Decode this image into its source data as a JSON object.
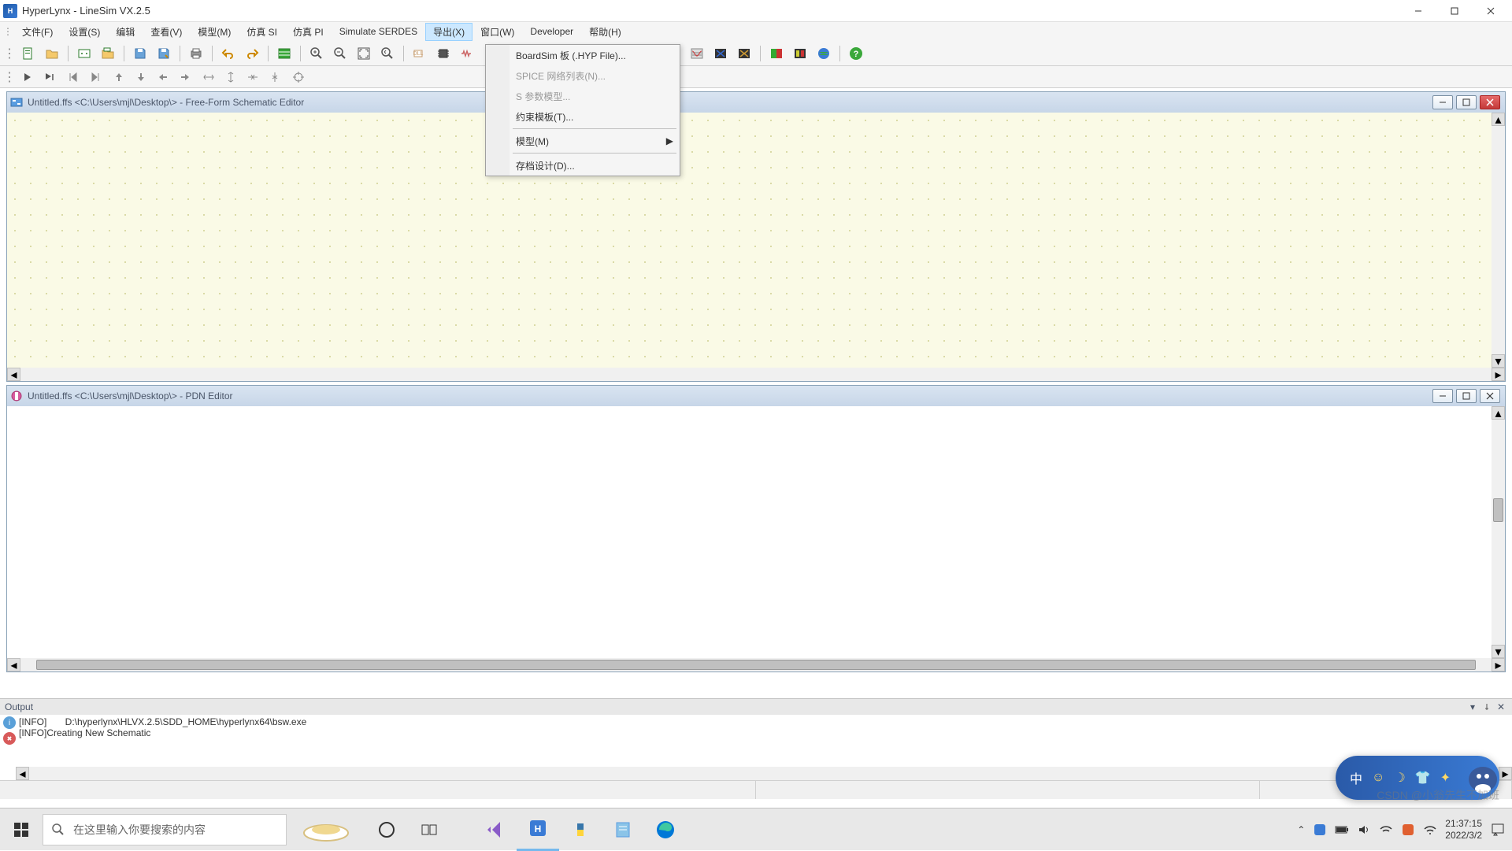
{
  "title": "HyperLynx - LineSim VX.2.5",
  "menubar": [
    "文件(F)",
    "设置(S)",
    "编辑",
    "查看(V)",
    "模型(M)",
    "仿真 SI",
    "仿真 PI",
    "Simulate SERDES",
    "导出(X)",
    "窗口(W)",
    "Developer",
    "帮助(H)"
  ],
  "menubar_active_index": 8,
  "dropdown": {
    "items": [
      {
        "label": "BoardSim 板 (.HYP File)...",
        "disabled": false
      },
      {
        "label": "SPICE 网络列表(N)...",
        "disabled": true
      },
      {
        "label": "S 参数模型...",
        "disabled": true
      },
      {
        "label": "约束模板(T)...",
        "disabled": false
      },
      {
        "sep": true
      },
      {
        "label": "模型(M)",
        "disabled": false,
        "arrow": true
      },
      {
        "sep": true
      },
      {
        "label": "存档设计(D)...",
        "disabled": false
      }
    ]
  },
  "editor1": {
    "title": "Untitled.ffs  <C:\\Users\\mjl\\Desktop\\>  -  Free-Form Schematic Editor"
  },
  "editor2": {
    "title": "Untitled.ffs  <C:\\Users\\mjl\\Desktop\\>  -  PDN Editor"
  },
  "output": {
    "title": "Output",
    "line1": "[INFO]       D:\\hyperlynx\\HLVX.2.5\\SDD_HOME\\hyperlynx64\\bsw.exe",
    "line2": "[INFO]Creating New Schematic"
  },
  "taskbar": {
    "search_placeholder": "在这里输入你要搜索的内容",
    "time": "21:37:15",
    "date": "2022/3/2"
  },
  "watermark": "CSDN @小翁先生不加班",
  "ime": "中"
}
